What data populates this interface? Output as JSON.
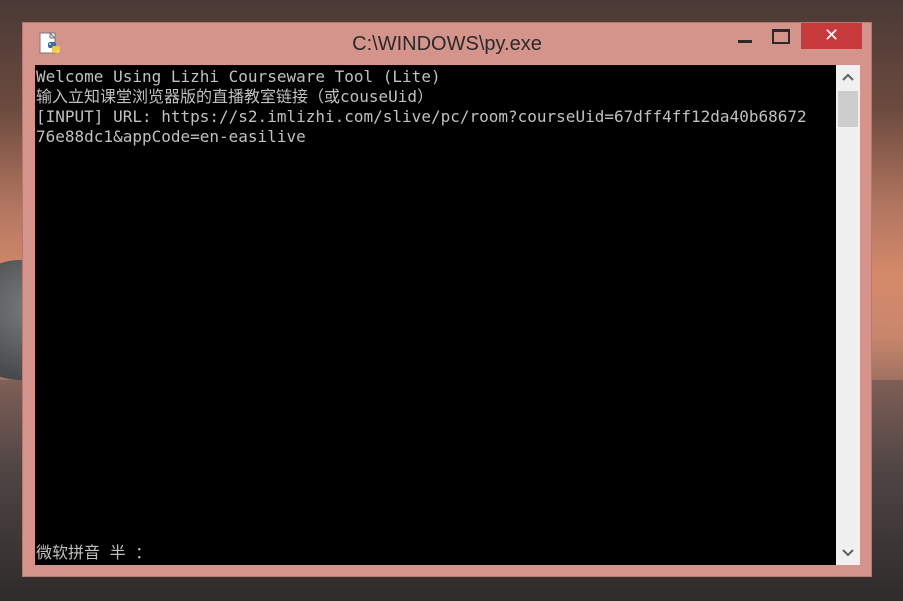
{
  "window": {
    "title": "C:\\WINDOWS\\py.exe",
    "app_icon": "python-icon",
    "controls": {
      "minimize_icon": "minimize-icon",
      "maximize_icon": "maximize-icon",
      "close_label": "✕"
    },
    "accent_color": "#d4938b",
    "close_color": "#c7393a"
  },
  "console": {
    "lines": [
      "Welcome Using Lizhi Courseware Tool (Lite)",
      "输入立知课堂浏览器版的直播教室链接（或couseUid）",
      "[INPUT] URL: https://s2.imlizhi.com/slive/pc/room?courseUid=67dff4ff12da40b68672",
      "76e88dc1&appCode=en-easilive"
    ],
    "ime_status": "微软拼音 半 ：",
    "text_color": "#c0c0c0",
    "background": "#000000"
  },
  "scrollbar": {
    "up_label": "︿",
    "down_label": "﹀"
  }
}
